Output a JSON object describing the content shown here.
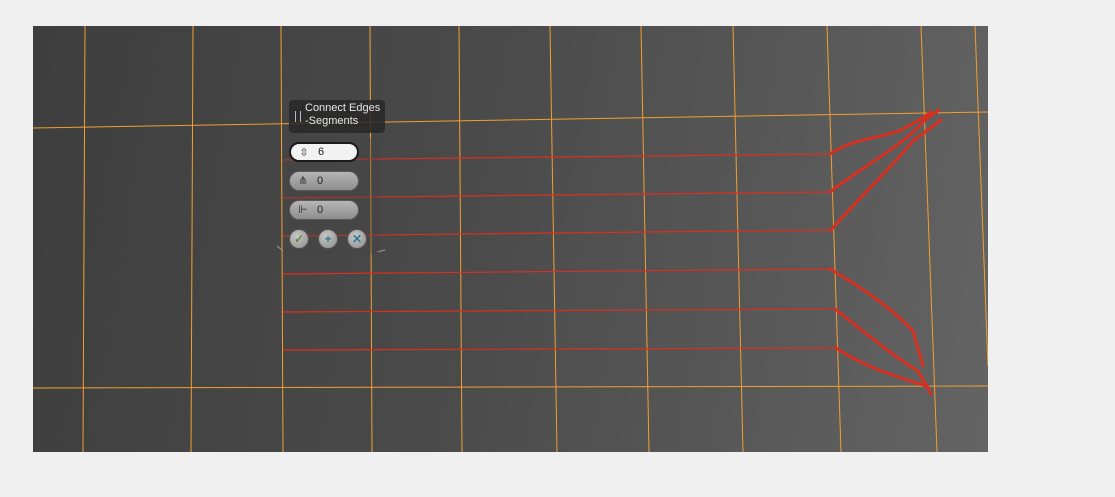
{
  "caddy": {
    "title_line1": "Connect Edges",
    "title_line2": "-Segments",
    "fields": [
      {
        "name": "segments",
        "icon": "segments-icon",
        "value": "6",
        "active": true
      },
      {
        "name": "pinch",
        "icon": "pinch-icon",
        "value": "0",
        "active": false
      },
      {
        "name": "slide",
        "icon": "slide-icon",
        "value": "0",
        "active": false
      }
    ],
    "buttons": [
      {
        "name": "ok",
        "icon": "checkmark-icon"
      },
      {
        "name": "apply",
        "icon": "plus-icon"
      },
      {
        "name": "cancel",
        "icon": "x-icon"
      }
    ]
  },
  "colors": {
    "grid_edge": "#f0a030",
    "connected_edge": "#d83020",
    "viewport_bg": "#4a4a4a"
  }
}
